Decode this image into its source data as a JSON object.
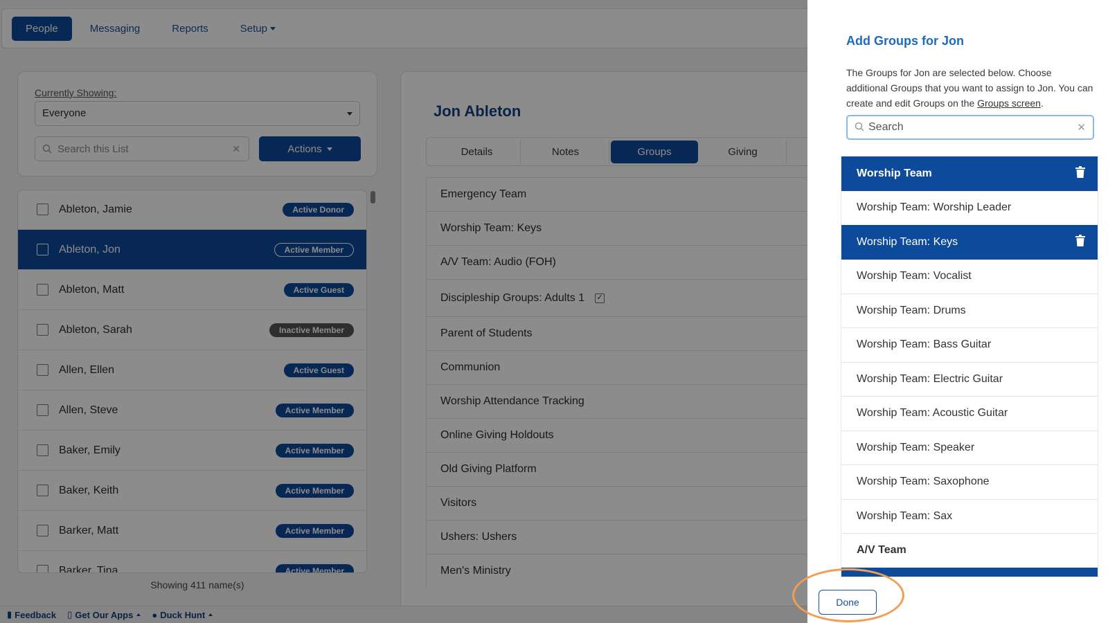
{
  "nav": {
    "items": [
      {
        "label": "People",
        "active": true,
        "caret": false
      },
      {
        "label": "Messaging",
        "active": false,
        "caret": false
      },
      {
        "label": "Reports",
        "active": false,
        "caret": false
      },
      {
        "label": "Setup",
        "active": false,
        "caret": true
      }
    ]
  },
  "filter": {
    "currently_showing_label": "Currently Showing:",
    "selected_value": "Everyone",
    "search_placeholder": "Search this List",
    "actions_label": "Actions"
  },
  "people": [
    {
      "name": "Ableton, Jamie",
      "status": "Active Donor",
      "selected": false
    },
    {
      "name": "Ableton, Jon",
      "status": "Active Member",
      "selected": true
    },
    {
      "name": "Ableton, Matt",
      "status": "Active Guest",
      "selected": false
    },
    {
      "name": "Ableton, Sarah",
      "status": "Inactive Member",
      "selected": false
    },
    {
      "name": "Allen, Ellen",
      "status": "Active Guest",
      "selected": false
    },
    {
      "name": "Allen, Steve",
      "status": "Active Member",
      "selected": false
    },
    {
      "name": "Baker, Emily",
      "status": "Active Member",
      "selected": false
    },
    {
      "name": "Baker, Keith",
      "status": "Active Member",
      "selected": false
    },
    {
      "name": "Barker, Matt",
      "status": "Active Member",
      "selected": false
    },
    {
      "name": "Barker, Tina",
      "status": "Active Member",
      "selected": false
    }
  ],
  "showing_count": "Showing 411 name(s)",
  "detail": {
    "person_name": "Jon Ableton",
    "tabs": [
      {
        "label": "Details",
        "active": false
      },
      {
        "label": "Notes",
        "active": false
      },
      {
        "label": "Groups",
        "active": true
      },
      {
        "label": "Giving",
        "active": false
      }
    ],
    "groups": [
      {
        "label": "Emergency Team",
        "checkbox": false
      },
      {
        "label": "Worship Team: Keys",
        "checkbox": false
      },
      {
        "label": "A/V Team: Audio (FOH)",
        "checkbox": false
      },
      {
        "label": "Discipleship Groups: Adults 1",
        "checkbox": true
      },
      {
        "label": "Parent of Students",
        "checkbox": false
      },
      {
        "label": "Communion",
        "checkbox": false
      },
      {
        "label": "Worship Attendance Tracking",
        "checkbox": false
      },
      {
        "label": "Online Giving Holdouts",
        "checkbox": false
      },
      {
        "label": "Old Giving Platform",
        "checkbox": false
      },
      {
        "label": "Visitors",
        "checkbox": false
      },
      {
        "label": "Ushers: Ushers",
        "checkbox": false
      },
      {
        "label": "Men's Ministry",
        "checkbox": false
      }
    ]
  },
  "bottombar": {
    "feedback": "Feedback",
    "get_apps": "Get Our Apps",
    "duck_hunt": "Duck Hunt"
  },
  "panel": {
    "title": "Add Groups for Jon",
    "desc_before": "The Groups for Jon are selected below. Choose additional Groups that you want to assign to Jon. You can create and edit Groups on the ",
    "desc_link": "Groups screen",
    "desc_after": ".",
    "search_placeholder": "Search",
    "items": [
      {
        "label": "Worship Team",
        "selected": true,
        "header": true
      },
      {
        "label": "Worship Team: Worship Leader",
        "selected": false,
        "header": false
      },
      {
        "label": "Worship Team: Keys",
        "selected": true,
        "header": false
      },
      {
        "label": "Worship Team: Vocalist",
        "selected": false,
        "header": false
      },
      {
        "label": "Worship Team: Drums",
        "selected": false,
        "header": false
      },
      {
        "label": "Worship Team: Bass Guitar",
        "selected": false,
        "header": false
      },
      {
        "label": "Worship Team: Electric Guitar",
        "selected": false,
        "header": false
      },
      {
        "label": "Worship Team: Acoustic Guitar",
        "selected": false,
        "header": false
      },
      {
        "label": "Worship Team: Speaker",
        "selected": false,
        "header": false
      },
      {
        "label": "Worship Team: Saxophone",
        "selected": false,
        "header": false
      },
      {
        "label": "Worship Team: Sax",
        "selected": false,
        "header": false
      },
      {
        "label": "A/V Team",
        "selected": false,
        "header": true
      },
      {
        "label": "",
        "selected": true,
        "header": true
      }
    ],
    "done_label": "Done"
  },
  "colors": {
    "primary": "#0e4a9a",
    "panel_title": "#1c6bbf",
    "highlight_ring": "#f39c53"
  }
}
